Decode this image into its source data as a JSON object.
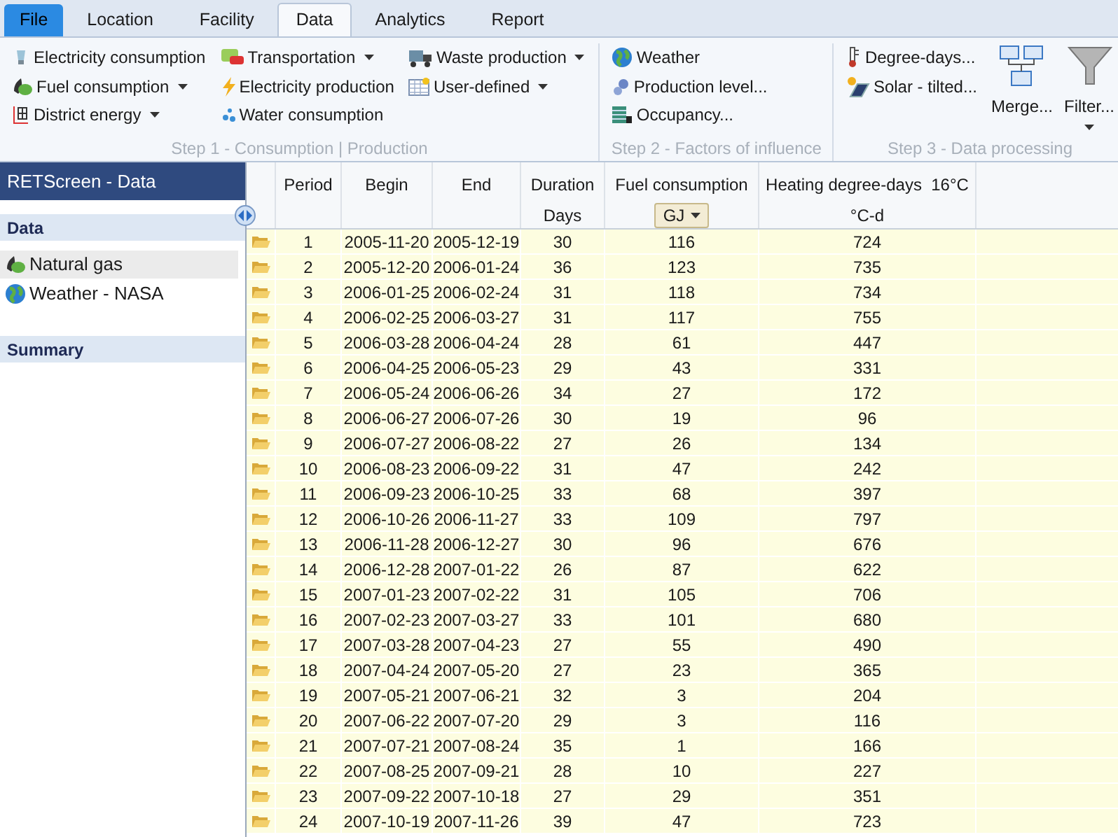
{
  "tabs": [
    {
      "label": "File",
      "kind": "app",
      "selected": false
    },
    {
      "label": "Location",
      "kind": "tab",
      "selected": false
    },
    {
      "label": "Facility",
      "kind": "tab",
      "selected": false
    },
    {
      "label": "Data",
      "kind": "tab",
      "selected": true
    },
    {
      "label": "Analytics",
      "kind": "tab",
      "selected": false
    },
    {
      "label": "Report",
      "kind": "tab",
      "selected": false
    }
  ],
  "ribbon": [
    {
      "caption": "Step 1 - Consumption | Production",
      "columns": [
        [
          {
            "label": "Electricity consumption",
            "dropdown": false
          },
          {
            "label": "Fuel consumption",
            "dropdown": true
          },
          {
            "label": "District energy",
            "dropdown": true
          }
        ],
        [
          {
            "label": "Transportation",
            "dropdown": true
          },
          {
            "label": "Electricity production",
            "dropdown": false
          },
          {
            "label": "Water consumption",
            "dropdown": false
          }
        ],
        [
          {
            "label": "Waste production",
            "dropdown": true
          },
          {
            "label": "User-defined",
            "dropdown": true
          }
        ]
      ]
    },
    {
      "caption": "Step 2 - Factors of influence",
      "columns": [
        [
          {
            "label": "Weather",
            "dropdown": false
          },
          {
            "label": "Production level...",
            "dropdown": false
          },
          {
            "label": "Occupancy...",
            "dropdown": false
          }
        ]
      ]
    },
    {
      "caption": "Step 3 - Data processing",
      "columns": [
        [
          {
            "label": "Degree-days...",
            "dropdown": false
          },
          {
            "label": "Solar - tilted...",
            "dropdown": false
          }
        ]
      ],
      "large": [
        {
          "label": "Merge...",
          "dropdown": false
        },
        {
          "label": "Filter...",
          "dropdown": true
        }
      ]
    }
  ],
  "sidebar": {
    "title": "RETScreen - Data",
    "sections": [
      {
        "heading": "Data",
        "items": [
          {
            "label": "Natural gas",
            "selected": true
          },
          {
            "label": "Weather - NASA",
            "selected": false
          }
        ]
      },
      {
        "heading": "Summary"
      }
    ]
  },
  "table": {
    "columns": [
      {
        "label": "Period"
      },
      {
        "label": "Begin"
      },
      {
        "label": "End"
      },
      {
        "label": "Duration",
        "sub": "Days"
      },
      {
        "label": "Fuel consumption",
        "unit": "GJ"
      },
      {
        "label": "Heating degree-days  16°C",
        "sub": "°C-d"
      }
    ],
    "rows": [
      [
        "1",
        "2005-11-20",
        "2005-12-19",
        "30",
        "116",
        "724"
      ],
      [
        "2",
        "2005-12-20",
        "2006-01-24",
        "36",
        "123",
        "735"
      ],
      [
        "3",
        "2006-01-25",
        "2006-02-24",
        "31",
        "118",
        "734"
      ],
      [
        "4",
        "2006-02-25",
        "2006-03-27",
        "31",
        "117",
        "755"
      ],
      [
        "5",
        "2006-03-28",
        "2006-04-24",
        "28",
        "61",
        "447"
      ],
      [
        "6",
        "2006-04-25",
        "2006-05-23",
        "29",
        "43",
        "331"
      ],
      [
        "7",
        "2006-05-24",
        "2006-06-26",
        "34",
        "27",
        "172"
      ],
      [
        "8",
        "2006-06-27",
        "2006-07-26",
        "30",
        "19",
        "96"
      ],
      [
        "9",
        "2006-07-27",
        "2006-08-22",
        "27",
        "26",
        "134"
      ],
      [
        "10",
        "2006-08-23",
        "2006-09-22",
        "31",
        "47",
        "242"
      ],
      [
        "11",
        "2006-09-23",
        "2006-10-25",
        "33",
        "68",
        "397"
      ],
      [
        "12",
        "2006-10-26",
        "2006-11-27",
        "33",
        "109",
        "797"
      ],
      [
        "13",
        "2006-11-28",
        "2006-12-27",
        "30",
        "96",
        "676"
      ],
      [
        "14",
        "2006-12-28",
        "2007-01-22",
        "26",
        "87",
        "622"
      ],
      [
        "15",
        "2007-01-23",
        "2007-02-22",
        "31",
        "105",
        "706"
      ],
      [
        "16",
        "2007-02-23",
        "2007-03-27",
        "33",
        "101",
        "680"
      ],
      [
        "17",
        "2007-03-28",
        "2007-04-23",
        "27",
        "55",
        "490"
      ],
      [
        "18",
        "2007-04-24",
        "2007-05-20",
        "27",
        "23",
        "365"
      ],
      [
        "19",
        "2007-05-21",
        "2007-06-21",
        "32",
        "3",
        "204"
      ],
      [
        "20",
        "2007-06-22",
        "2007-07-20",
        "29",
        "3",
        "116"
      ],
      [
        "21",
        "2007-07-21",
        "2007-08-24",
        "35",
        "1",
        "166"
      ],
      [
        "22",
        "2007-08-25",
        "2007-09-21",
        "28",
        "10",
        "227"
      ],
      [
        "23",
        "2007-09-22",
        "2007-10-18",
        "27",
        "29",
        "351"
      ],
      [
        "24",
        "2007-10-19",
        "2007-11-26",
        "39",
        "47",
        "723"
      ]
    ]
  }
}
